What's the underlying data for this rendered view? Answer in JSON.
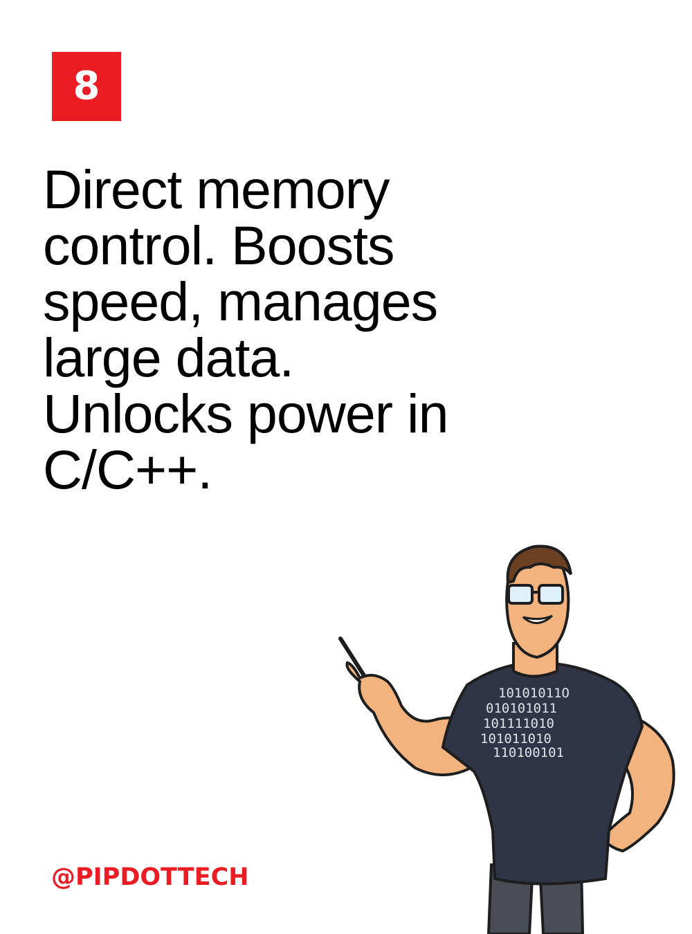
{
  "badge": {
    "number": "8"
  },
  "headline": {
    "lines": [
      "Direct memory",
      "control. Boosts",
      "speed, manages",
      "large data.",
      "Unlocks power in",
      "C/C++."
    ]
  },
  "footer": {
    "handle": "@PIPDOTTECH"
  },
  "mascot": {
    "shirt_binary": [
      "10101011O",
      "010101011",
      "101111010",
      "101011010",
      "110100101"
    ]
  },
  "colors": {
    "accent": "#ec1c24",
    "text": "#000000",
    "background": "#ffffff",
    "shirt": "#2f3446",
    "skin": "#f2b37f"
  }
}
